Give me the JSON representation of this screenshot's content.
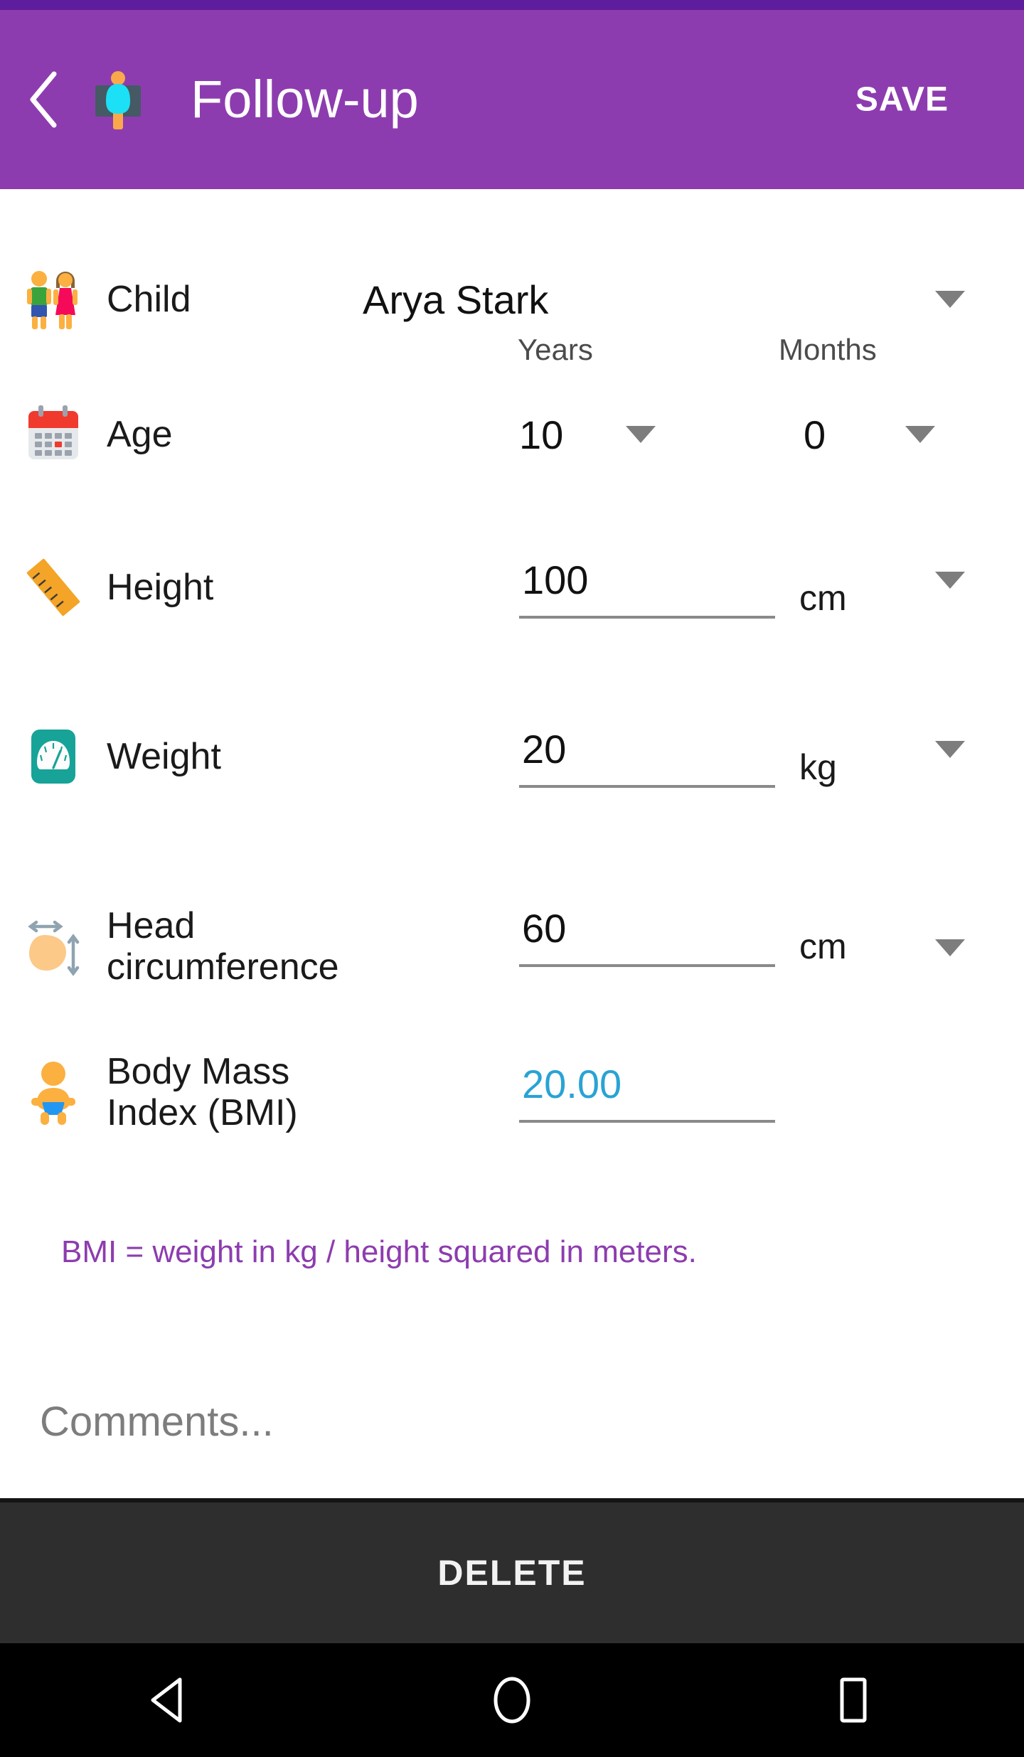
{
  "statusbar": {
    "color": "#5e1d9c"
  },
  "appbar": {
    "title": "Follow-up",
    "save_label": "SAVE",
    "background": "#8d3caf",
    "back_icon": "chevron-left-icon",
    "logo_icon": "child-growth-app-icon"
  },
  "form": {
    "child": {
      "icon": "boy-and-girl-emoji",
      "label": "Child",
      "value": "Arya Stark",
      "dropdown_icon": "caret-down-icon"
    },
    "age": {
      "icon": "calendar-emoji",
      "label": "Age",
      "years_header": "Years",
      "months_header": "Months",
      "years_value": "10",
      "months_value": "0",
      "dropdown_icon": "caret-down-icon"
    },
    "height": {
      "icon": "ruler-emoji",
      "label": "Height",
      "value": "100",
      "unit": "cm",
      "dropdown_icon": "caret-down-icon"
    },
    "weight": {
      "icon": "weight-scale-emoji",
      "label": "Weight",
      "value": "20",
      "unit": "kg",
      "dropdown_icon": "caret-down-icon"
    },
    "head_circumference": {
      "icon": "head-measure-icon",
      "label": "Head circumference",
      "value": "60",
      "unit": "cm",
      "dropdown_icon": "caret-down-icon"
    },
    "bmi": {
      "icon": "baby-emoji",
      "label": "Body Mass Index (BMI)",
      "value": "20.00",
      "value_color": "#29a3d4"
    },
    "bmi_hint": "BMI = weight in kg / height squared in meters.",
    "bmi_hint_color": "#8d3caf",
    "comments_placeholder": "Comments...",
    "comments_value": ""
  },
  "delete": {
    "label": "DELETE",
    "background": "#2e2e2e"
  },
  "navbar": {
    "back_icon": "nav-back-triangle-icon",
    "home_icon": "nav-home-circle-icon",
    "recents_icon": "nav-recents-square-icon"
  }
}
